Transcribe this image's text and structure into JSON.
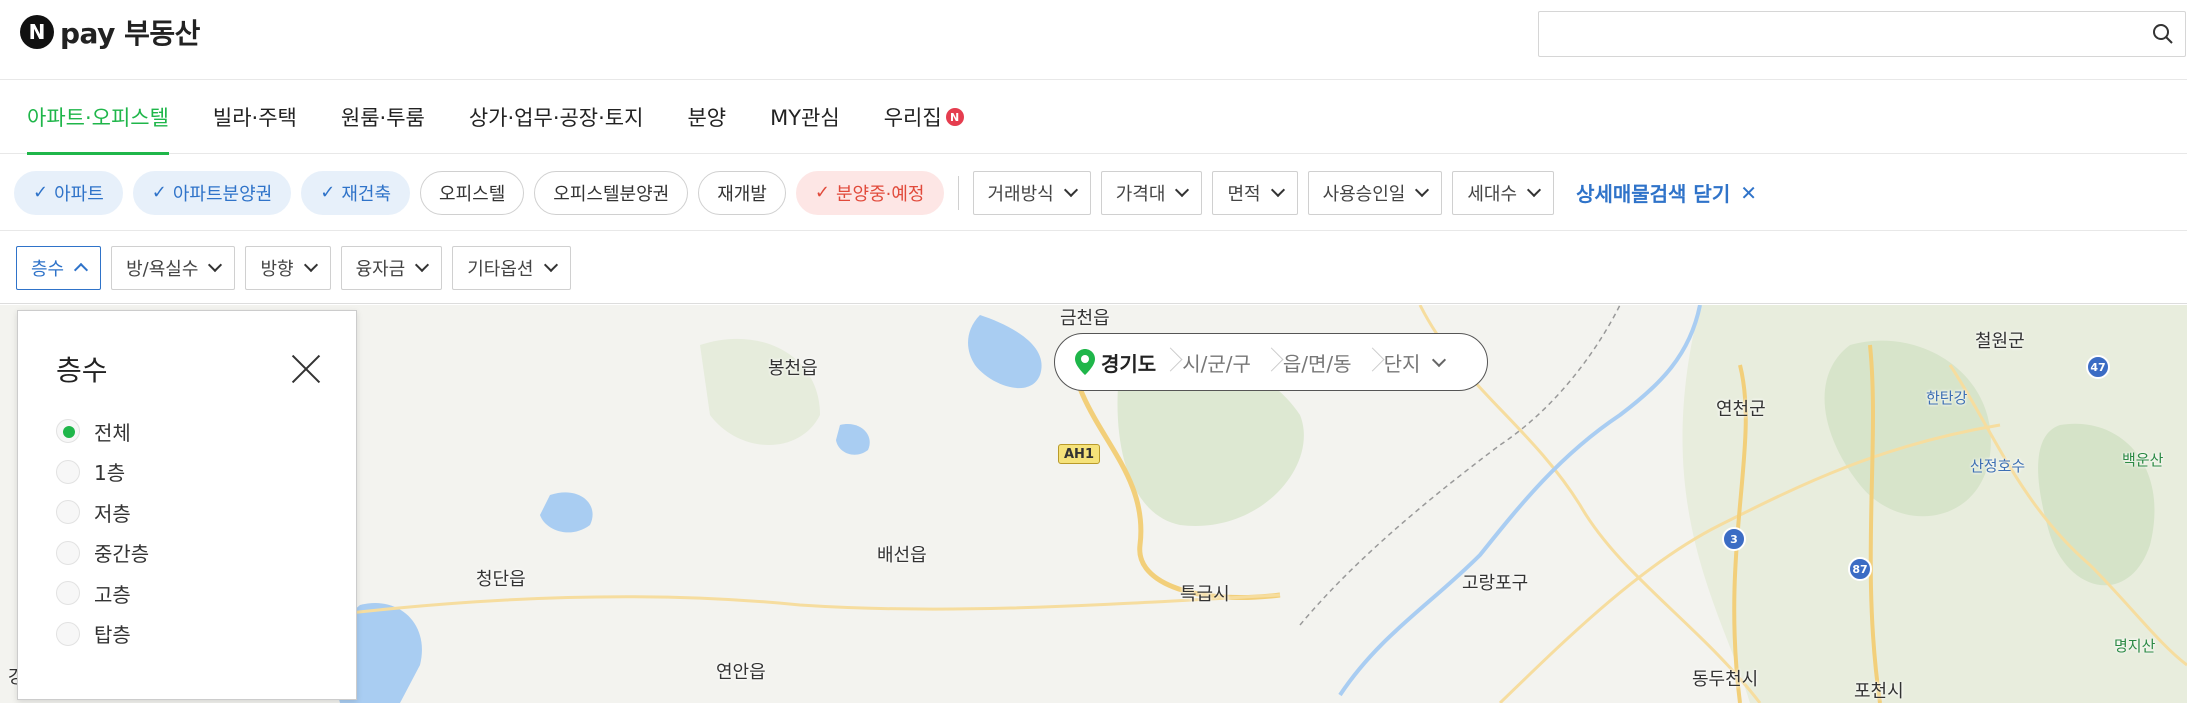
{
  "header": {
    "logo_badge": "N",
    "logo_text": "pay 부동산",
    "search_placeholder": ""
  },
  "tabs": [
    {
      "label": "아파트·오피스텔",
      "active": true
    },
    {
      "label": "빌라·주택"
    },
    {
      "label": "원룸·투룸"
    },
    {
      "label": "상가·업무·공장·토지"
    },
    {
      "label": "분양"
    },
    {
      "label": "MY관심"
    },
    {
      "label": "우리집",
      "badge": "N"
    }
  ],
  "filters": {
    "chips": [
      {
        "label": "아파트",
        "check": "✓",
        "state": "on"
      },
      {
        "label": "아파트분양권",
        "check": "✓",
        "state": "on"
      },
      {
        "label": "재건축",
        "check": "✓",
        "state": "on"
      },
      {
        "label": "오피스텔",
        "state": "off"
      },
      {
        "label": "오피스텔분양권",
        "state": "off"
      },
      {
        "label": "재개발",
        "state": "off"
      },
      {
        "label": "분양중·예정",
        "check": "✓",
        "state": "red"
      }
    ],
    "dropdowns": [
      "거래방식",
      "가격대",
      "면적",
      "사용승인일",
      "세대수"
    ],
    "close_detail_label": "상세매물검색 닫기",
    "close_icon": "✕",
    "row2": [
      "층수",
      "방/욕실수",
      "방향",
      "융자금",
      "기타옵션"
    ]
  },
  "region": {
    "province": "경기도",
    "city": "시/군/구",
    "town": "읍/면/동",
    "complex": "단지"
  },
  "floor_panel": {
    "title": "층수",
    "options": [
      "전체",
      "1층",
      "저층",
      "중간층",
      "고층",
      "탑층"
    ],
    "selected": "전체"
  },
  "map": {
    "places": [
      "금천읍",
      "봉천읍",
      "철원군",
      "연천군",
      "한탄강",
      "산정호수",
      "백운산",
      "청단읍",
      "배선읍",
      "특급시",
      "고랑포구",
      "연안읍",
      "동두천시",
      "포천시",
      "명지산",
      "강"
    ],
    "road_badges": [
      "AH1",
      "47",
      "3",
      "87"
    ]
  },
  "colors": {
    "accent_green": "#1fb64a",
    "chip_blue": "#2f73c9",
    "chip_red": "#e14a3b"
  }
}
